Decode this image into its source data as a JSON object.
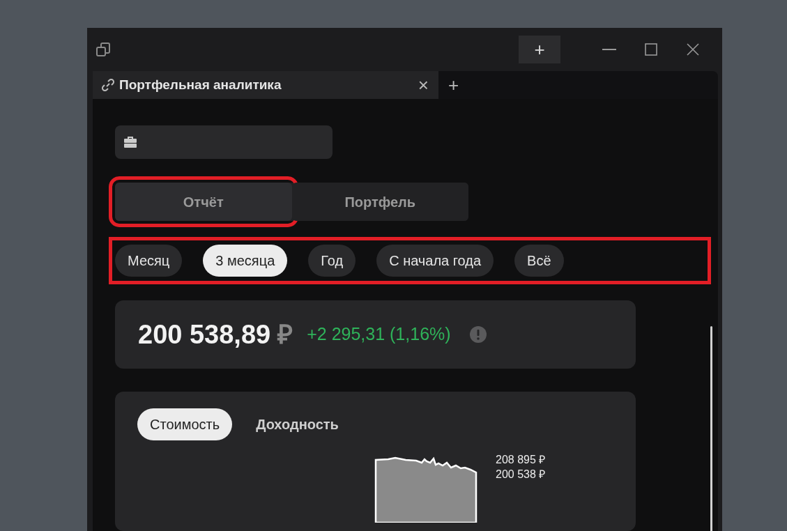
{
  "window": {
    "new_tab_button": "+"
  },
  "tab": {
    "title": "Портфельная аналитика",
    "close": "×",
    "add": "+"
  },
  "mode_tabs": [
    {
      "label": "Отчёт",
      "selected": true,
      "highlighted": true
    },
    {
      "label": "Портфель",
      "selected": false,
      "highlighted": false
    }
  ],
  "period_filters": {
    "highlighted": true,
    "items": [
      {
        "label": "Месяц",
        "selected": false
      },
      {
        "label": "3 месяца",
        "selected": true
      },
      {
        "label": "Год",
        "selected": false
      },
      {
        "label": "С начала года",
        "selected": false
      },
      {
        "label": "Всё",
        "selected": false
      }
    ]
  },
  "summary": {
    "value": "200 538,89",
    "currency": "₽",
    "change": "+2 295,31 (1,16%)"
  },
  "chart_tabs": [
    {
      "label": "Стоимость",
      "selected": true
    },
    {
      "label": "Доходность",
      "selected": false
    }
  ],
  "chart_labels": [
    "208 895 ₽",
    "200 538 ₽"
  ]
}
